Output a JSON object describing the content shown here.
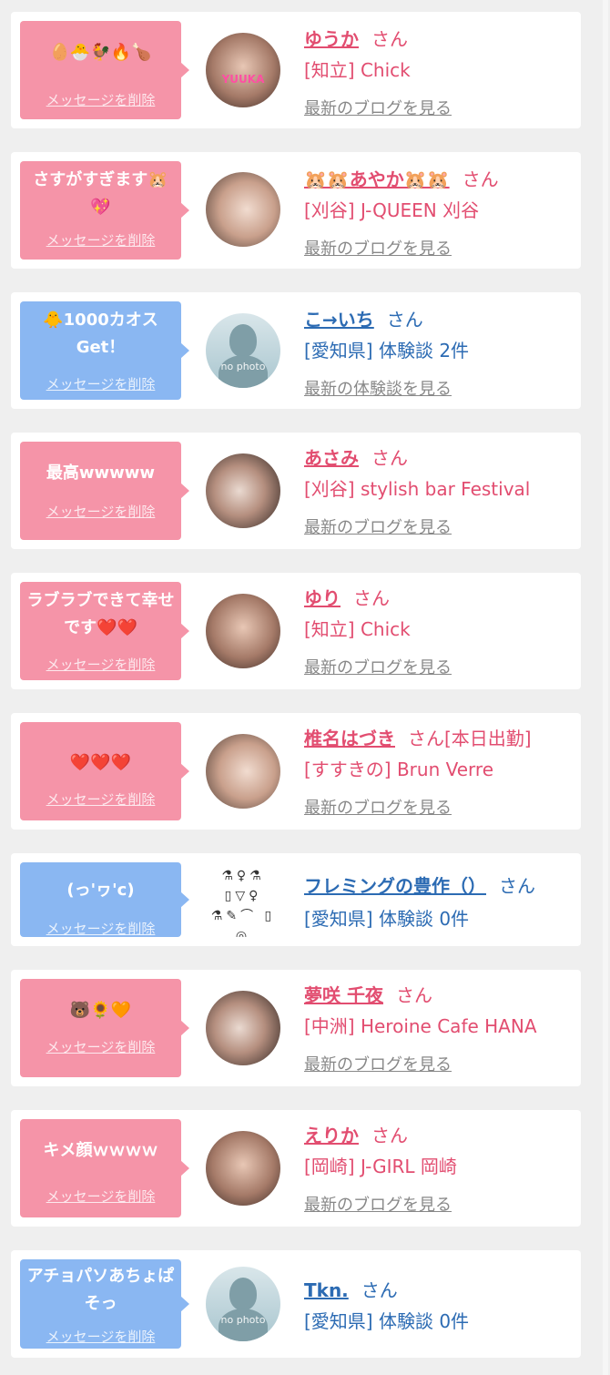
{
  "delete_label": "メッセージを削除",
  "items": [
    {
      "message": "🥚🐣🐓🔥🍗",
      "name": "ゆうか",
      "suffix": "さん",
      "shop": "[知立] Chick",
      "link": "最新のブログを見る",
      "avatar_badge": "YUUKA"
    },
    {
      "message": "さすがすぎます🐹💖",
      "name": "🐹🐹あやか🐹🐹",
      "suffix": "さん",
      "shop": "[刈谷] J-QUEEN 刈谷",
      "link": "最新のブログを見る"
    },
    {
      "message": "🐥1000カオス Get！",
      "name": "こ→いち",
      "suffix": "さん",
      "shop": "[愛知県] 体験談 2件",
      "link": "最新の体験談を見る",
      "avatar_text": "no photo"
    },
    {
      "message": "最高wwwww",
      "name": "あさみ",
      "suffix": "さん",
      "shop": "[刈谷] stylish bar Festival",
      "link": "最新のブログを見る"
    },
    {
      "message": "ラブラブできて幸せです❤️❤️",
      "name": "ゆり",
      "suffix": "さん",
      "shop": "[知立] Chick",
      "link": "最新のブログを見る"
    },
    {
      "message": "❤️❤️❤️",
      "name": "椎名はづき",
      "suffix": "さん[本日出勤]",
      "shop": "[すすきの] Brun Verre",
      "link": "最新のブログを見る"
    },
    {
      "message": "(っ'ヮ'c)",
      "name": "フレミングの豊作（）",
      "suffix": "さん",
      "shop": "[愛知県] 体験談 0件"
    },
    {
      "message": "🐻🌻🧡",
      "name": "夢咲 千夜",
      "suffix": "さん",
      "shop": "[中洲] Heroine Cafe HANA",
      "link": "最新のブログを見る"
    },
    {
      "message": "キメ顔ｗｗｗｗ",
      "name": "えりか",
      "suffix": "さん",
      "shop": "[岡崎] J-GIRL 岡崎",
      "link": "最新のブログを見る"
    },
    {
      "message": "アチョパソあちょぱそっ",
      "name": "Tkn.",
      "suffix": "さん",
      "shop": "[愛知県] 体験談 0件",
      "avatar_text": "no photo"
    }
  ],
  "icon_avatar_glyphs": "⚗♀⚗ ▯▽♀ ⚗✎⌒ ▯ ◎",
  "colors": {
    "pink": "#f594a8",
    "blue": "#8ab7f2",
    "name_pink": "#e24d70",
    "name_blue": "#2c6bb3"
  }
}
